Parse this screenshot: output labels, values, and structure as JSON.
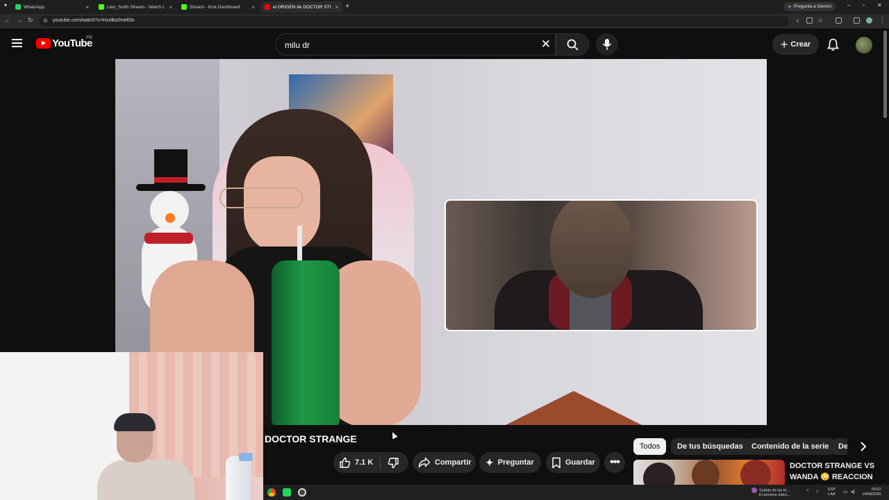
{
  "browser": {
    "tabs": [
      {
        "title": "WhatsApp",
        "favicon_color": "#25d366",
        "active": false
      },
      {
        "title": "Lian_Sorth Stream - Watch Live",
        "favicon_color": "#53fc18",
        "active": false
      },
      {
        "title": "Stream - Kick Dashboard",
        "favicon_color": "#53fc18",
        "active": false
      },
      {
        "title": "el ORIGEN de DOCTOR STRANGE",
        "favicon_color": "#ff0000",
        "active": true
      }
    ],
    "gemini_label": "Pregunta a Gemini",
    "url": "youtube.com/watch?v=Hzolko0mell3o"
  },
  "youtube": {
    "logo_text": "YouTube",
    "country_code": "PE",
    "search_query": "milu dr",
    "create_label": "Crear"
  },
  "video": {
    "title": "DOCTOR STRANGE",
    "likes": "7.1 K",
    "share_label": "Compartir",
    "ask_label": "Preguntar",
    "save_label": "Guardar"
  },
  "chips": [
    {
      "label": "Todos",
      "selected": true
    },
    {
      "label": "De tus búsquedas",
      "selected": false
    },
    {
      "label": "Contenido de la serie",
      "selected": false
    },
    {
      "label": "De",
      "selected": false
    }
  ],
  "recommendation": {
    "title": "DOCTOR STRANGE VS WANDA 😳 REACCION a DOCTOR STRANGE..."
  },
  "taskbar": {
    "news_line1": "Subida de las te...",
    "news_line2": "El próximo miérc...",
    "lang_line1": "ESP",
    "lang_line2": "LAA",
    "time": "00:52",
    "date": "14/08/2026"
  },
  "colors": {
    "youtube_red": "#ff0000",
    "background": "#0f0f0f",
    "pill": "#272727"
  }
}
